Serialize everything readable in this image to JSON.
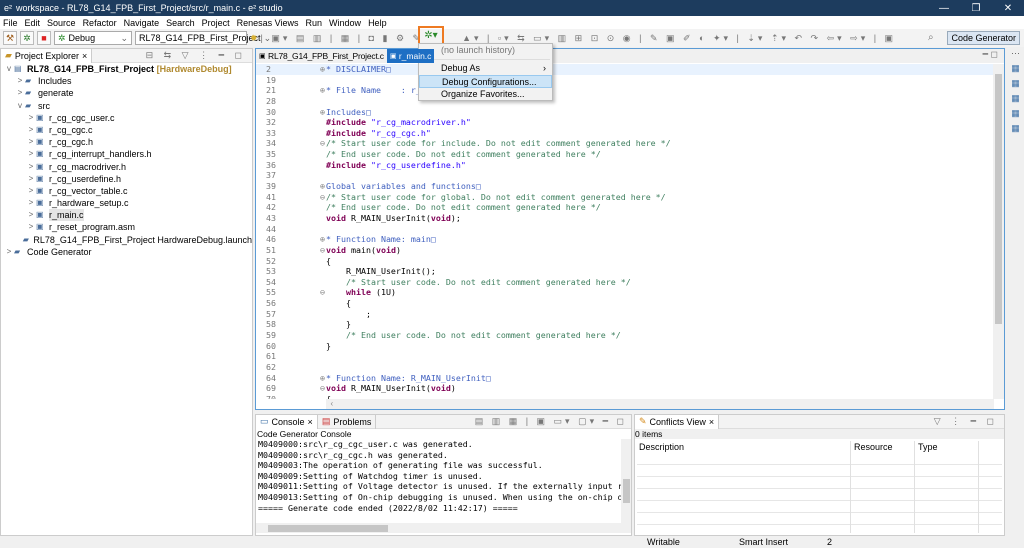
{
  "window": {
    "title": "workspace - RL78_G14_FPB_First_Project/src/r_main.c - e² studio",
    "minimize": "—",
    "maximize": "❐",
    "close": "✕"
  },
  "menu": [
    "File",
    "Edit",
    "Source",
    "Refactor",
    "Navigate",
    "Search",
    "Project",
    "Renesas Views",
    "Run",
    "Window",
    "Help"
  ],
  "toolbar": {
    "launch_mode": "Debug",
    "launch_config": "RL78_G14_FPB_First_Project",
    "perspective": "Code Generator"
  },
  "debug_menu": {
    "no_history": "(no launch history)",
    "items": [
      "Debug As",
      "Debug Configurations...",
      "Organize Favorites..."
    ],
    "submenu_arrow": "›"
  },
  "explorer": {
    "title": "Project Explorer",
    "project": "RL78_G14_FPB_First_Project",
    "project_config": "[HardwareDebug]",
    "items": [
      {
        "label": "Includes",
        "level": 1,
        "tw": ">"
      },
      {
        "label": "generate",
        "level": 1,
        "tw": ">"
      },
      {
        "label": "src",
        "level": 1,
        "tw": "v"
      },
      {
        "label": "r_cg_cgc_user.c",
        "level": 2,
        "tw": ">"
      },
      {
        "label": "r_cg_cgc.c",
        "level": 2,
        "tw": ">"
      },
      {
        "label": "r_cg_cgc.h",
        "level": 2,
        "tw": ">"
      },
      {
        "label": "r_cg_interrupt_handlers.h",
        "level": 2,
        "tw": ">"
      },
      {
        "label": "r_cg_macrodriver.h",
        "level": 2,
        "tw": ">"
      },
      {
        "label": "r_cg_userdefine.h",
        "level": 2,
        "tw": ">"
      },
      {
        "label": "r_cg_vector_table.c",
        "level": 2,
        "tw": ">"
      },
      {
        "label": "r_hardware_setup.c",
        "level": 2,
        "tw": ">"
      },
      {
        "label": "r_main.c",
        "level": 2,
        "tw": ">",
        "selected": true
      },
      {
        "label": "r_reset_program.asm",
        "level": 2,
        "tw": ">"
      },
      {
        "label": "RL78_G14_FPB_First_Project HardwareDebug.launch",
        "level": 1,
        "tw": ""
      },
      {
        "label": "Code Generator",
        "level": 0,
        "tw": ">"
      }
    ]
  },
  "editor": {
    "tabs": [
      "RL78_G14_FPB_First_Project.c",
      "r_main.c"
    ],
    "lines": [
      {
        "n": "2",
        "fold": "⊕",
        "p": [
          [
            "dc",
            "* DISCLAIMER□"
          ]
        ],
        "hl": true
      },
      {
        "n": "19",
        "p": []
      },
      {
        "n": "21",
        "fold": "⊕",
        "p": [
          [
            "dc",
            "* File Name    : r_main.c"
          ]
        ]
      },
      {
        "n": "28",
        "p": []
      },
      {
        "n": "30",
        "fold": "⊕",
        "p": [
          [
            "dc",
            "Includes□"
          ]
        ]
      },
      {
        "n": "32",
        "p": [
          [
            "pp",
            "#include "
          ],
          [
            "str",
            "\"r_cg_macrodriver.h\""
          ]
        ]
      },
      {
        "n": "33",
        "p": [
          [
            "pp",
            "#include "
          ],
          [
            "str",
            "\"r_cg_cgc.h\""
          ]
        ]
      },
      {
        "n": "34",
        "fold": "⊖",
        "p": [
          [
            "cm",
            "/* Start user code for include. Do not edit comment generated here */"
          ]
        ]
      },
      {
        "n": "35",
        "p": [
          [
            "cm",
            "/* End user code. Do not edit comment generated here */"
          ]
        ]
      },
      {
        "n": "36",
        "p": [
          [
            "pp",
            "#include "
          ],
          [
            "str",
            "\"r_cg_userdefine.h\""
          ]
        ]
      },
      {
        "n": "37",
        "p": []
      },
      {
        "n": "39",
        "fold": "⊕",
        "p": [
          [
            "dc",
            "Global variables and functions□"
          ]
        ]
      },
      {
        "n": "41",
        "fold": "⊖",
        "p": [
          [
            "cm",
            "/* Start user code for global. Do not edit comment generated here */"
          ]
        ]
      },
      {
        "n": "42",
        "p": [
          [
            "cm",
            "/* End user code. Do not edit comment generated here */"
          ]
        ]
      },
      {
        "n": "43",
        "p": [
          [
            "kw",
            "void "
          ],
          [
            "tx",
            "R_MAIN_UserInit("
          ],
          [
            "kw",
            "void"
          ],
          [
            "tx",
            ");"
          ]
        ]
      },
      {
        "n": "44",
        "p": []
      },
      {
        "n": "46",
        "fold": "⊕",
        "p": [
          [
            "dc",
            "* Function Name: main□"
          ]
        ]
      },
      {
        "n": "51",
        "fold": "⊖",
        "p": [
          [
            "kw",
            "void "
          ],
          [
            "tx",
            "main("
          ],
          [
            "kw",
            "void"
          ],
          [
            "tx",
            ")"
          ]
        ]
      },
      {
        "n": "52",
        "p": [
          [
            "tx",
            "{"
          ]
        ]
      },
      {
        "n": "53",
        "p": [
          [
            "tx",
            "    R_MAIN_UserInit();"
          ]
        ]
      },
      {
        "n": "54",
        "p": [
          [
            "cm",
            "    /* Start user code. Do not edit comment generated here */"
          ]
        ]
      },
      {
        "n": "55",
        "fold": "⊖",
        "p": [
          [
            "kw",
            "    while "
          ],
          [
            "tx",
            "(1U)"
          ]
        ]
      },
      {
        "n": "56",
        "p": [
          [
            "tx",
            "    {"
          ]
        ]
      },
      {
        "n": "57",
        "p": [
          [
            "tx",
            "        ;"
          ]
        ]
      },
      {
        "n": "58",
        "p": [
          [
            "tx",
            "    }"
          ]
        ]
      },
      {
        "n": "59",
        "p": [
          [
            "cm",
            "    /* End user code. Do not edit comment generated here */"
          ]
        ]
      },
      {
        "n": "60",
        "p": [
          [
            "tx",
            "}"
          ]
        ]
      },
      {
        "n": "61",
        "p": []
      },
      {
        "n": "62",
        "p": []
      },
      {
        "n": "64",
        "fold": "⊕",
        "p": [
          [
            "dc",
            "* Function Name: R_MAIN_UserInit□"
          ]
        ]
      },
      {
        "n": "69",
        "fold": "⊖",
        "p": [
          [
            "kw",
            "void "
          ],
          [
            "tx",
            "R_MAIN_UserInit("
          ],
          [
            "kw",
            "void"
          ],
          [
            "tx",
            ")"
          ]
        ]
      },
      {
        "n": "70",
        "p": [
          [
            "tx",
            "{"
          ]
        ]
      }
    ]
  },
  "console": {
    "tabs": [
      "Console",
      "Problems"
    ],
    "title": "Code Generator Console",
    "lines": [
      "M0409000:src\\r_cg_cgc_user.c was generated.",
      "M0409000:src\\r_cg_cgc.h was generated.",
      "M0409003:The operation of generating file was successful.",
      "M0409009:Setting of Watchdog timer is unused.",
      "M0409011:Setting of Voltage detector is unused. If the externally input rese",
      "M0409013:Setting of On-chip debugging is unused. When using the on-chip debu",
      "===== Generate code ended (2022/8/02 11:42:17) ====="
    ]
  },
  "conflicts": {
    "title": "Conflicts View",
    "count": "0 items",
    "columns": [
      "Description",
      "Resource",
      "Type"
    ]
  },
  "status": {
    "mode": "Writable",
    "insert": "Smart Insert",
    "position": "2"
  }
}
